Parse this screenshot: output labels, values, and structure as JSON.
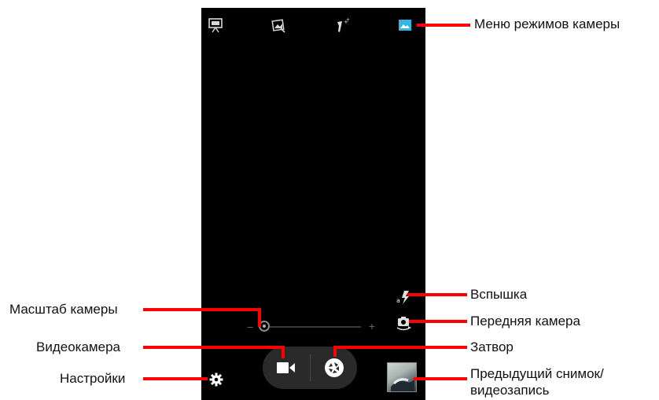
{
  "callouts": {
    "camera_modes_menu": "Меню режимов камеры",
    "flash": "Вспышка",
    "front_camera": "Передняя камера",
    "shutter": "Затвор",
    "previous_shot_line1": "Предыдущий снимок/",
    "previous_shot_line2": "видеозапись",
    "camera_zoom": "Масштаб камеры",
    "video_camera": "Видеокамера",
    "settings": "Настройки"
  },
  "icons": {
    "mode_panorama": "panorama-mode-icon",
    "mode_image_effects": "image-effects-icon",
    "mode_face": "face-beauty-icon",
    "mode_normal": "normal-photo-mode-icon",
    "flash": "auto-flash-icon",
    "front_camera": "switch-camera-icon",
    "video": "video-camera-icon",
    "shutter": "shutter-aperture-icon",
    "settings": "gear-icon"
  },
  "zoom": {
    "minus_symbol": "−",
    "plus_symbol": "+",
    "level": 0.05
  },
  "colors": {
    "callout_red": "#ff0000",
    "screen_bg": "#000000",
    "accent_blue": "#33b5e5"
  }
}
